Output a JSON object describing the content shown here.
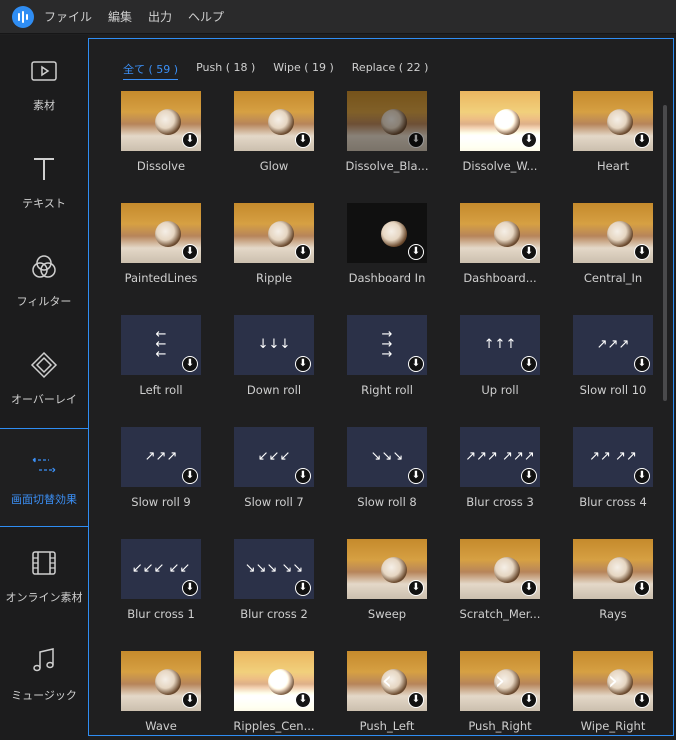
{
  "menubar": {
    "items": [
      "ファイル",
      "編集",
      "出力",
      "ヘルプ"
    ]
  },
  "sidebar": {
    "items": [
      {
        "label": "素材",
        "icon": "media-icon"
      },
      {
        "label": "テキスト",
        "icon": "text-icon"
      },
      {
        "label": "フィルター",
        "icon": "filter-icon"
      },
      {
        "label": "オーバーレイ",
        "icon": "overlay-icon"
      },
      {
        "label": "画面切替効果",
        "icon": "transition-icon"
      },
      {
        "label": "オンライン素材",
        "icon": "film-icon"
      },
      {
        "label": "ミュージック",
        "icon": "music-icon"
      }
    ],
    "active_index": 4
  },
  "tabs": [
    {
      "label": "全て ( 59 )"
    },
    {
      "label": "Push ( 18 )"
    },
    {
      "label": "Wipe ( 19 )"
    },
    {
      "label": "Replace ( 22 )"
    }
  ],
  "transitions": [
    {
      "name": "Dissolve",
      "kind": "cat"
    },
    {
      "name": "Glow",
      "kind": "cat"
    },
    {
      "name": "Dissolve_Bla...",
      "kind": "cat-dim"
    },
    {
      "name": "Dissolve_W...",
      "kind": "cat-light"
    },
    {
      "name": "Heart",
      "kind": "cat"
    },
    {
      "name": "PaintedLines",
      "kind": "cat"
    },
    {
      "name": "Ripple",
      "kind": "cat"
    },
    {
      "name": "Dashboard In",
      "kind": "cat-dark"
    },
    {
      "name": "Dashboard...",
      "kind": "cat"
    },
    {
      "name": "Central_In",
      "kind": "cat"
    },
    {
      "name": "Left roll",
      "kind": "nav",
      "glyphs": "←\n←\n←"
    },
    {
      "name": "Down roll",
      "kind": "nav",
      "glyphs": "↓↓↓"
    },
    {
      "name": "Right roll",
      "kind": "nav",
      "glyphs": "→\n→\n→"
    },
    {
      "name": "Up roll",
      "kind": "nav",
      "glyphs": "↑↑↑"
    },
    {
      "name": "Slow roll 10",
      "kind": "nav",
      "glyphs": "↗↗↗"
    },
    {
      "name": "Slow roll 9",
      "kind": "nav",
      "glyphs": "↗↗↗"
    },
    {
      "name": "Slow roll 7",
      "kind": "nav",
      "glyphs": "↙↙↙"
    },
    {
      "name": "Slow roll 8",
      "kind": "nav",
      "glyphs": "↘↘↘"
    },
    {
      "name": "Blur cross 3",
      "kind": "nav",
      "glyphs": "↗↗↗ ↗↗↗"
    },
    {
      "name": "Blur cross 4",
      "kind": "nav",
      "glyphs": "↗↗ ↗↗"
    },
    {
      "name": "Blur cross 1",
      "kind": "nav",
      "glyphs": "↙↙↙ ↙↙"
    },
    {
      "name": "Blur cross 2",
      "kind": "nav",
      "glyphs": "↘↘↘ ↘↘"
    },
    {
      "name": "Sweep",
      "kind": "cat"
    },
    {
      "name": "Scratch_Mer...",
      "kind": "cat"
    },
    {
      "name": "Rays",
      "kind": "cat"
    },
    {
      "name": "Wave",
      "kind": "cat"
    },
    {
      "name": "Ripples_Cen...",
      "kind": "cat-light"
    },
    {
      "name": "Push_Left",
      "kind": "cat",
      "glyphs": "‹"
    },
    {
      "name": "Push_Right",
      "kind": "cat",
      "glyphs": "›"
    },
    {
      "name": "Wipe_Right",
      "kind": "cat",
      "glyphs": "›"
    }
  ],
  "colors": {
    "accent": "#2f8df3",
    "background": "#1f1f20",
    "thumb_nav": "#2b3148"
  }
}
